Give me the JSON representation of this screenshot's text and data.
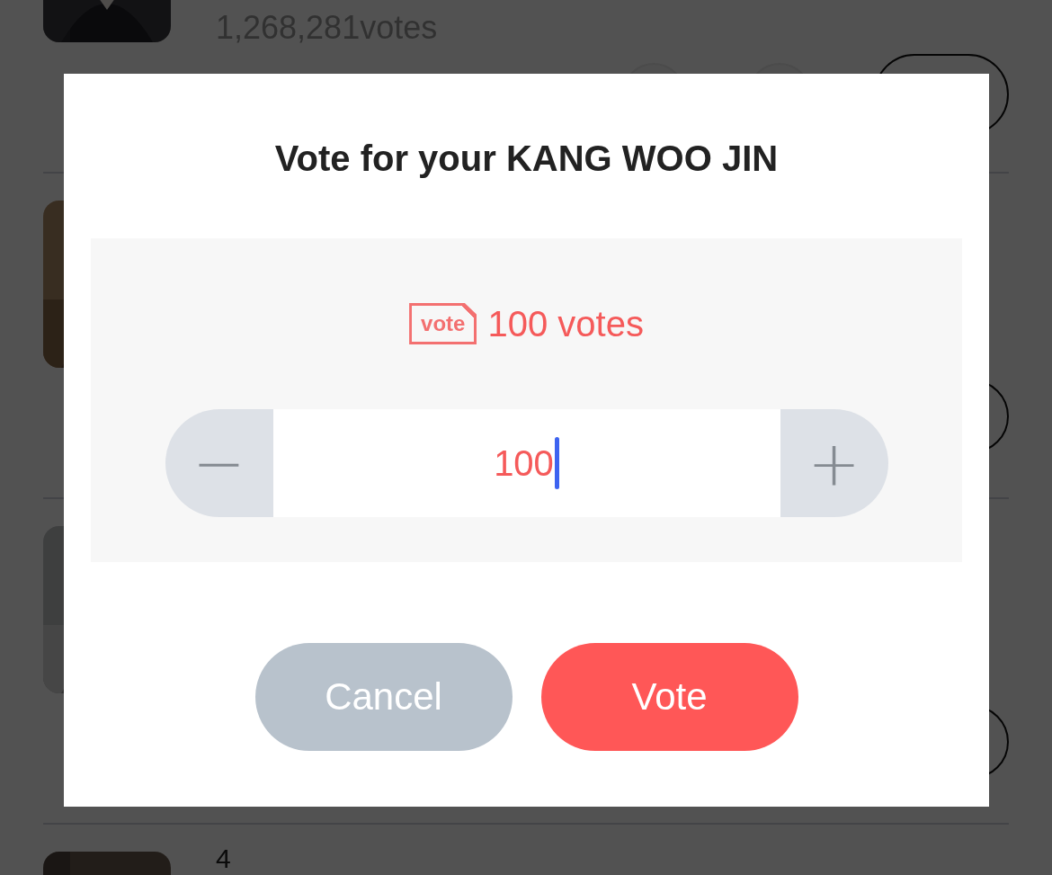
{
  "list_rows": [
    {
      "votes": "1,268,281votes",
      "action_buttons": [
        {
          "kind": "round"
        },
        {
          "kind": "round"
        },
        {
          "kind": "pill"
        }
      ]
    },
    {
      "action_buttons": [
        {
          "kind": "round"
        }
      ]
    },
    {
      "action_buttons": [
        {
          "kind": "round"
        }
      ]
    },
    {
      "rank": "4",
      "action_buttons": []
    }
  ],
  "dialog": {
    "title": "Vote for your KANG WOO JIN",
    "ticket_label": "vote",
    "vote_count": "100 votes",
    "stepper": {
      "minus": "−",
      "value": "100",
      "plus": "+"
    },
    "buttons": [
      {
        "label": "Cancel",
        "kind": "cancel"
      },
      {
        "label": "Vote",
        "kind": "primary"
      }
    ]
  }
}
